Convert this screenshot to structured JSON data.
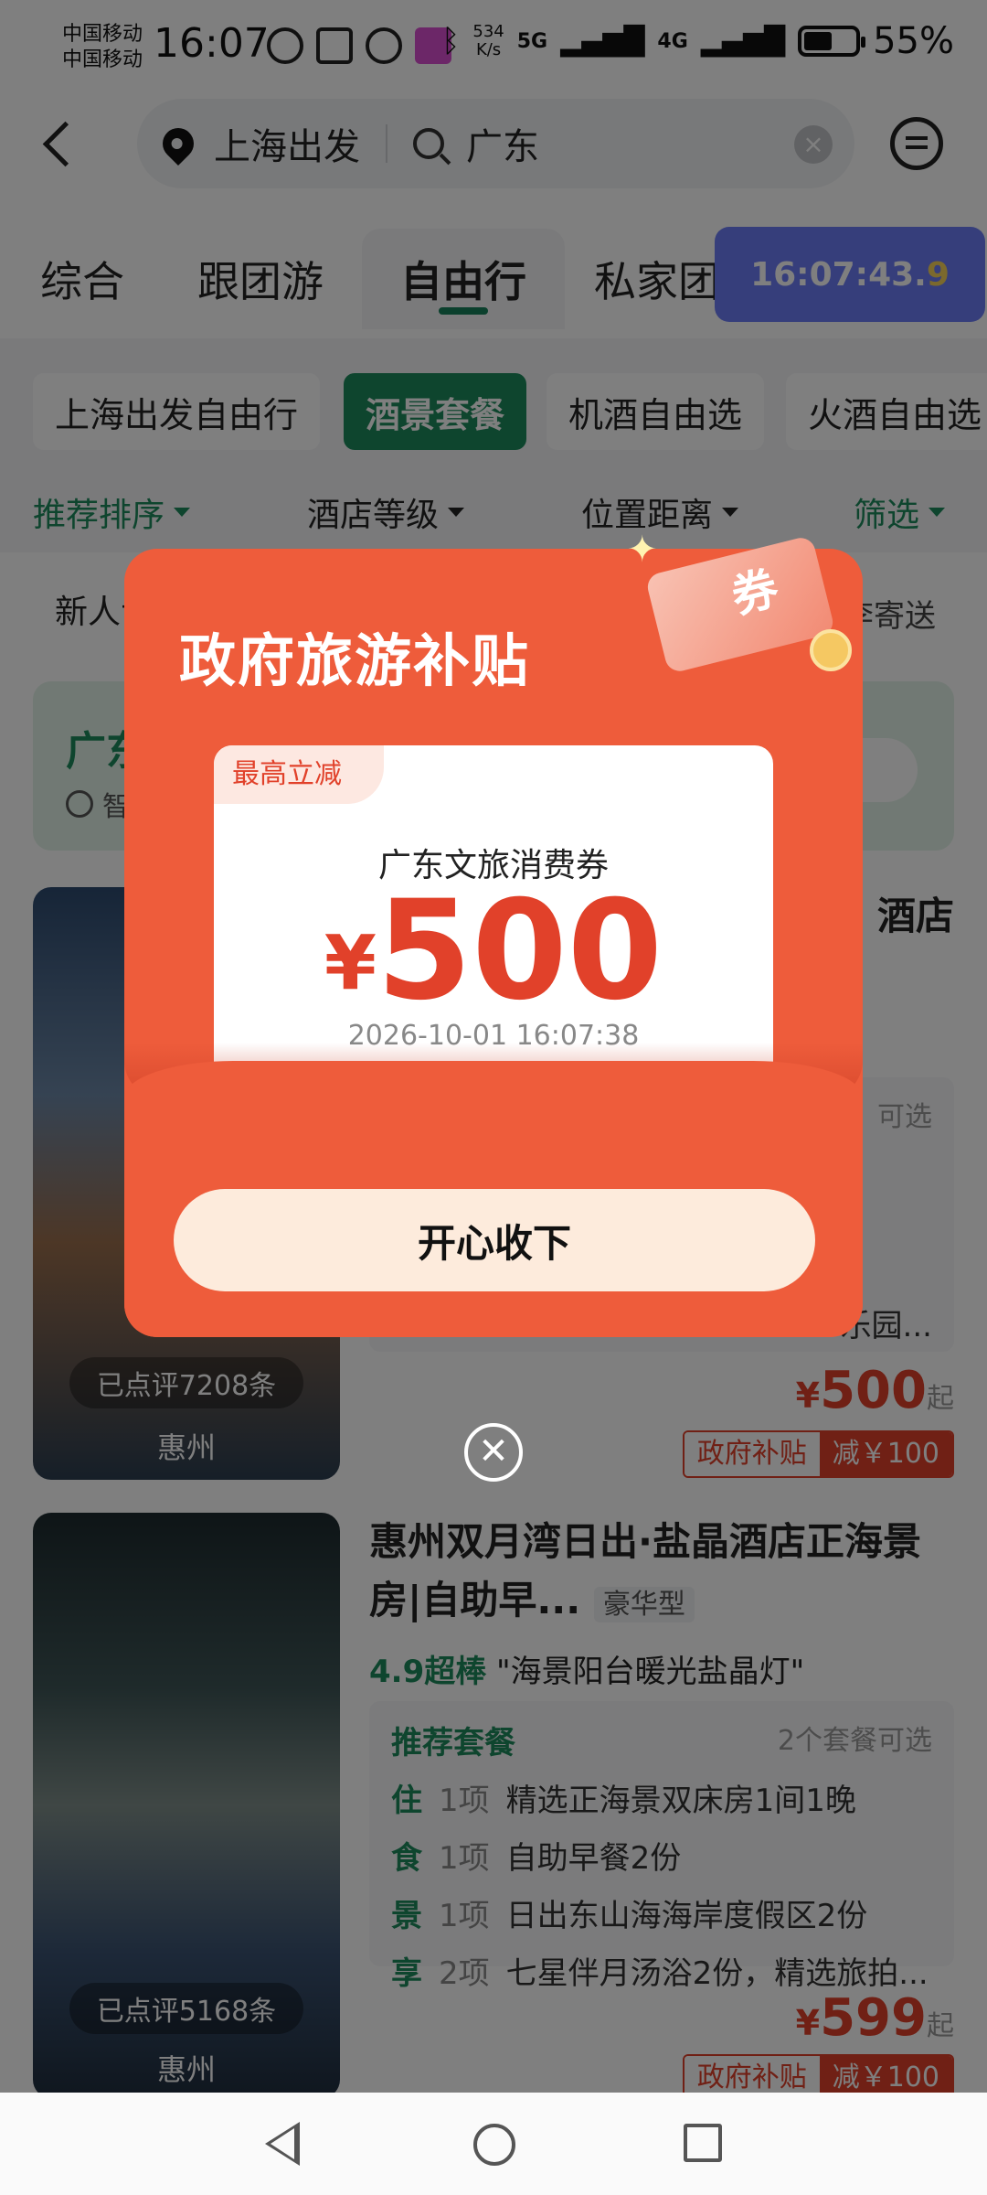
{
  "status_bar": {
    "carrier_1": "中国移动",
    "carrier_2": "中国移动",
    "time": "16:07",
    "speed_value": "534",
    "speed_unit": "K/s",
    "net_1": "5G",
    "net_2": "4G",
    "battery": "55%"
  },
  "header": {
    "departure": "上海出发",
    "destination": "广东"
  },
  "tabs": [
    {
      "label": "综合"
    },
    {
      "label": "跟团游"
    },
    {
      "label": "自由行"
    },
    {
      "label": "私家团"
    }
  ],
  "timer_overlay": {
    "main": "16:07:43.",
    "last_digit": "9"
  },
  "chips": [
    {
      "label": "上海出发自由行"
    },
    {
      "label": "酒景套餐"
    },
    {
      "label": "机酒自由选"
    },
    {
      "label": "火酒自由选"
    }
  ],
  "sort": {
    "recommend": "推荐排序",
    "hotel_level": "酒店等级",
    "distance": "位置距离",
    "filter": "筛选"
  },
  "promo_strip": {
    "left": "新人专享",
    "right": "行李寄送"
  },
  "banner": {
    "title": "广东",
    "subtitle": "智"
  },
  "listings": [
    {
      "title_suffix": "酒店",
      "reviews": "已点评7208条",
      "city": "惠州",
      "pkg_more": "可选",
      "last_line": "乐园...",
      "price_currency": "¥",
      "price": "500",
      "price_suffix": "起",
      "subsidy_label": "政府补贴",
      "subsidy_value": "减￥100"
    },
    {
      "title": "惠州双月湾日出·盐晶酒店正海景房|自助早...",
      "title_tag": "豪华型",
      "score": "4.9",
      "score_label": "超棒",
      "quote": "\"海景阳台暖光盐晶灯\"",
      "reviews": "已点评5168条",
      "city": "惠州",
      "pkg_head": "推荐套餐",
      "pkg_more": "2个套餐可选",
      "items": [
        {
          "k": "住",
          "n": "1项",
          "text": "精选正海景双床房1间1晚"
        },
        {
          "k": "食",
          "n": "1项",
          "text": "自助早餐2份"
        },
        {
          "k": "景",
          "n": "1项",
          "text": "日出东山海海岸度假区2份"
        },
        {
          "k": "享",
          "n": "2项",
          "text": "七星伴月汤浴2份，精选旅拍..."
        }
      ],
      "price_currency": "¥",
      "price": "599",
      "price_suffix": "起",
      "subsidy_label": "政府补贴",
      "subsidy_value": "减￥100"
    }
  ],
  "modal": {
    "title": "政府旅游补贴",
    "ticket_char": "券",
    "coupon_tag": "最高立减",
    "coupon_name": "广东文旅消费券",
    "currency": "¥",
    "amount": "500",
    "datetime": "2026-10-01 16:07:38",
    "claim_button": "开心收下",
    "close_symbol": "✕"
  },
  "colors": {
    "brand_green": "#1c8a5c",
    "modal_orange": "#ee5c3b",
    "price_red": "#e1412a",
    "timer_blue": "#6c7cf7"
  }
}
